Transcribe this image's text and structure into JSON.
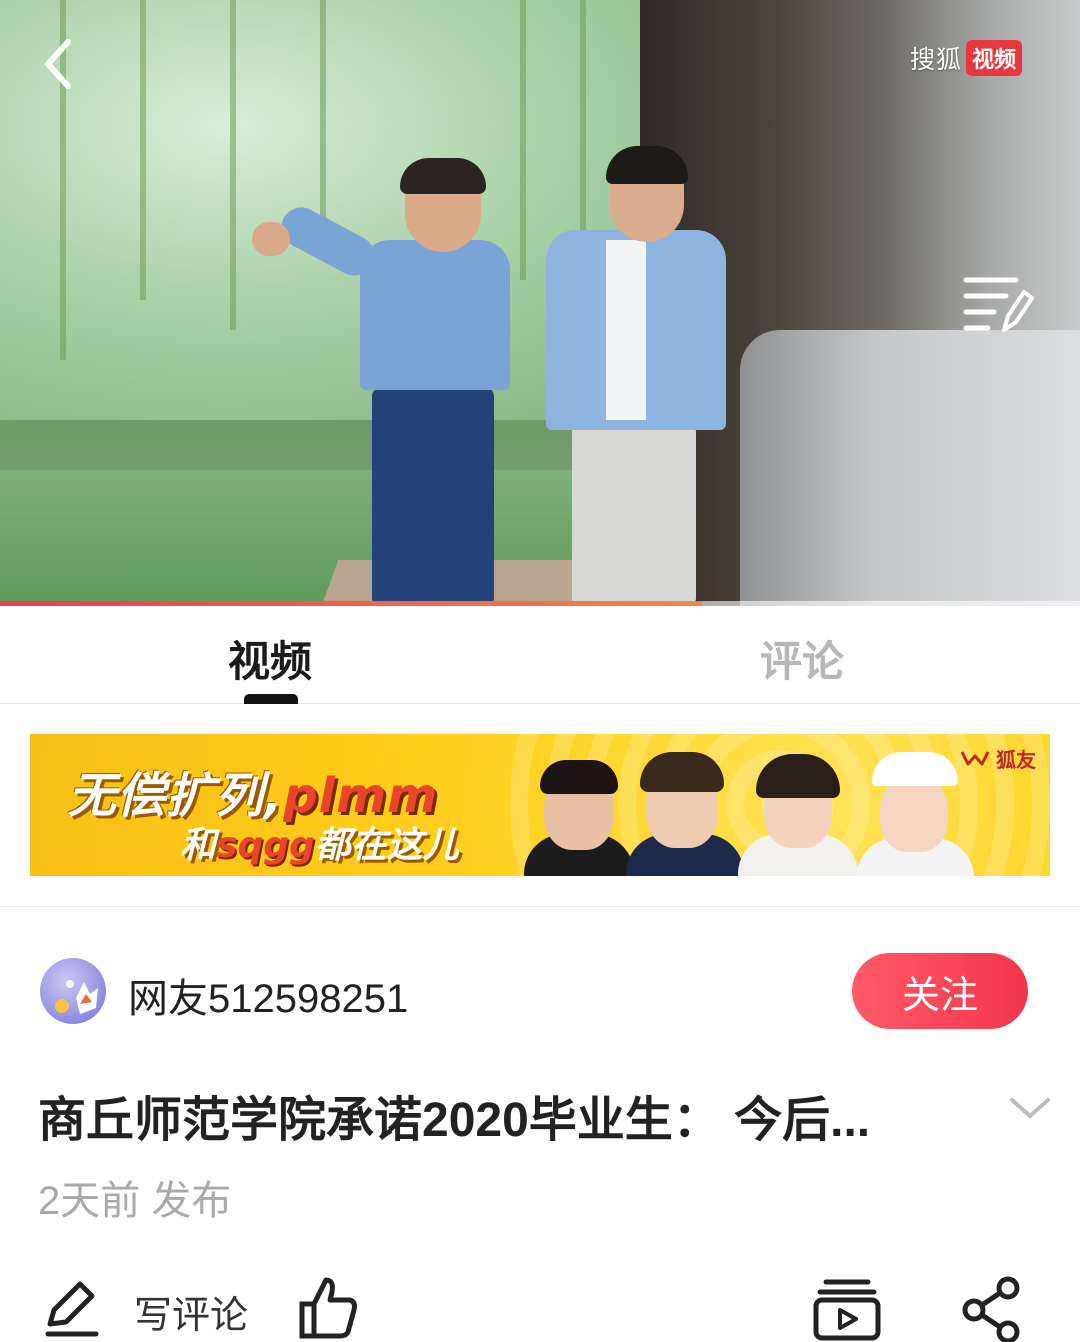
{
  "player": {
    "brand_text": "搜狐",
    "brand_badge": "视频",
    "progress": 0.65,
    "icons": {
      "back": "chevron-left-icon",
      "playlist": "playlist-edit-icon"
    }
  },
  "tabs": [
    {
      "label": "视频",
      "active": true
    },
    {
      "label": "评论",
      "active": false
    }
  ],
  "banner": {
    "line1_cn": "无偿扩列,",
    "line1_latin": "plmm",
    "line2_cn_a": "和",
    "line2_latin": "sqgg",
    "line2_cn_b": "都在这儿",
    "logo_text": "狐友"
  },
  "author": {
    "name": "网友512598251",
    "follow_label": "关注"
  },
  "video": {
    "title": "商丘师范学院承诺2020毕业生： 今后...",
    "publish_time": "2天前 发布"
  },
  "actions": {
    "write_comment_label": "写评论",
    "icons": [
      "edit-icon",
      "thumbs-up-icon",
      "video-playlist-icon",
      "share-icon"
    ]
  },
  "colors": {
    "accent": "#f3364b",
    "tab_active": "#1b1b1b",
    "tab_inactive": "#b7b7b7",
    "progress_start": "#e83d4f",
    "progress_end": "#f0864a"
  }
}
